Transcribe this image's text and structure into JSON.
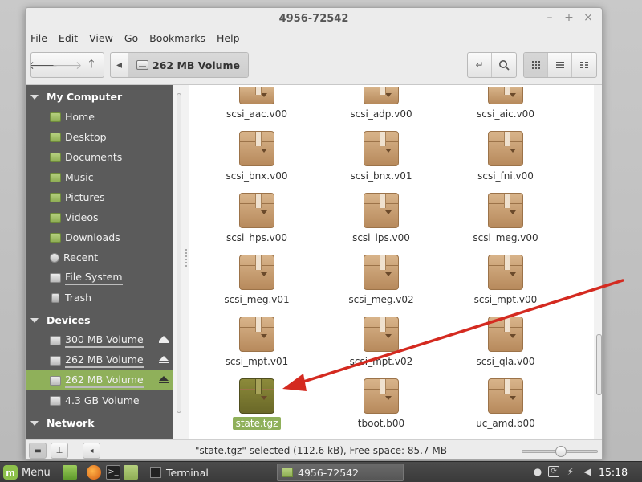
{
  "window": {
    "title": "4956-72542"
  },
  "menubar": [
    "File",
    "Edit",
    "View",
    "Go",
    "Bookmarks",
    "Help"
  ],
  "toolbar": {
    "location": "262 MB Volume",
    "view_modes": [
      "icon-view",
      "list-view",
      "compact-view"
    ]
  },
  "sidebar": {
    "my_computer": {
      "header": "My Computer",
      "items": [
        "Home",
        "Desktop",
        "Documents",
        "Music",
        "Pictures",
        "Videos",
        "Downloads",
        "Recent",
        "File System",
        "Trash"
      ]
    },
    "devices": {
      "header": "Devices",
      "items": [
        "300 MB Volume",
        "262 MB Volume",
        "262 MB Volume",
        "4.3 GB Volume"
      ],
      "selected_index": 2
    },
    "network": {
      "header": "Network"
    }
  },
  "files": [
    "scsi_aac.v00",
    "scsi_adp.v00",
    "scsi_aic.v00",
    "scsi_bnx.v00",
    "scsi_bnx.v01",
    "scsi_fni.v00",
    "scsi_hps.v00",
    "scsi_ips.v00",
    "scsi_meg.v00",
    "scsi_meg.v01",
    "scsi_meg.v02",
    "scsi_mpt.v00",
    "scsi_mpt.v01",
    "scsi_mpt.v02",
    "scsi_qla.v00",
    "state.tgz",
    "tboot.b00",
    "uc_amd.b00"
  ],
  "selected_file": "state.tgz",
  "status": {
    "text": "\"state.tgz\" selected (112.6 kB), Free space: 85.7 MB",
    "zoom_level": 0.5
  },
  "taskbar": {
    "menu_label": "Menu",
    "tasks": [
      "Terminal",
      "4956-72542"
    ],
    "clock": "15:18"
  },
  "colors": {
    "accent": "#8fb05a",
    "sidebar_bg": "#5b5b5b",
    "annotation_arrow": "#d42a20"
  }
}
